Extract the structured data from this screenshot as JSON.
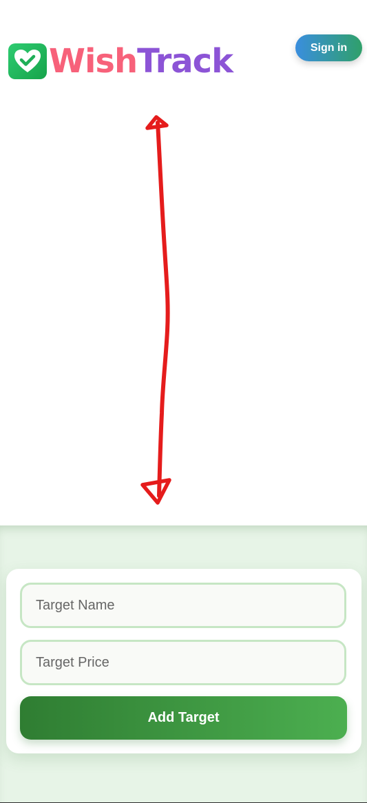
{
  "header": {
    "logo": {
      "part1": "Wish",
      "part2": "Track"
    },
    "signin_label": "Sign in"
  },
  "form": {
    "name_placeholder": "Target Name",
    "price_placeholder": "Target Price",
    "name_value": "",
    "price_value": "",
    "submit_label": "Add Target"
  },
  "icons": {
    "logo": "heart-check-icon",
    "annotation": "double-headed-arrow-icon"
  },
  "colors": {
    "logo_wish": "#f7617a",
    "logo_track": "#8c54d6",
    "logo_badge": "#22b85a",
    "signin_gradient_start": "#3a8ede",
    "signin_gradient_end": "#2fa06a",
    "section_bg": "#e7f4e7",
    "input_border": "#c6e6c4",
    "button_gradient_start": "#2f7d32",
    "button_gradient_end": "#4caf50",
    "annotation": "#e51c1c"
  }
}
